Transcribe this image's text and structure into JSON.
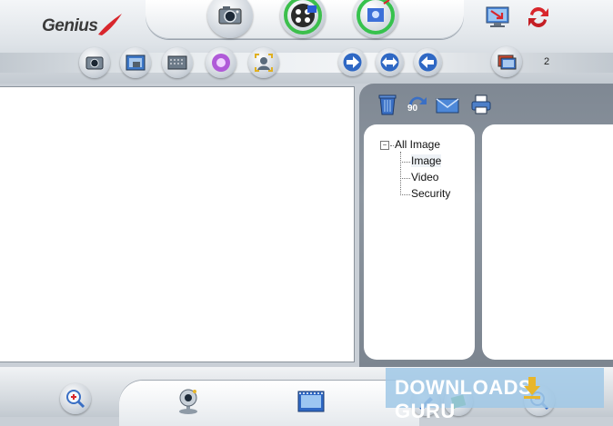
{
  "brand": {
    "logo_text": "Genius"
  },
  "colors": {
    "accent_red": "#d8262c",
    "panel_gray": "#8a939d",
    "watermark_bg": "#a9cde6",
    "watermark_arrow": "#e8b62b"
  },
  "mode_tabs": [
    {
      "icon": "camera-icon"
    },
    {
      "icon": "film-reel-icon"
    },
    {
      "icon": "security-camera-icon"
    }
  ],
  "top_right": [
    {
      "icon": "monitor-arrow-icon"
    },
    {
      "icon": "refresh-icon"
    }
  ],
  "toolbar": [
    {
      "icon": "capture-photo-icon"
    },
    {
      "icon": "photo-frame-icon"
    },
    {
      "icon": "scan-icon"
    },
    {
      "icon": "effects-icon"
    },
    {
      "icon": "face-frame-icon"
    },
    {
      "icon": "arrow-right-icon"
    },
    {
      "icon": "arrow-both-icon"
    },
    {
      "icon": "arrow-left-icon"
    },
    {
      "icon": "gallery-icon"
    }
  ],
  "page_number": "2",
  "file_tools": [
    {
      "icon": "trash-icon"
    },
    {
      "icon": "rotate-90-icon",
      "label": "90"
    },
    {
      "icon": "email-icon"
    },
    {
      "icon": "printer-icon"
    }
  ],
  "tree": {
    "root": "All Image",
    "expander": "−",
    "children": [
      "Image",
      "Video",
      "Security"
    ]
  },
  "bottom": [
    {
      "icon": "zoom-in-icon"
    },
    {
      "icon": "webcam-icon"
    },
    {
      "icon": "filmstrip-icon"
    },
    {
      "icon": "edit-icon"
    },
    {
      "icon": "zoom-out-icon"
    }
  ],
  "watermark": {
    "text": "DOWNLOADS",
    "suffix": "GURU"
  }
}
